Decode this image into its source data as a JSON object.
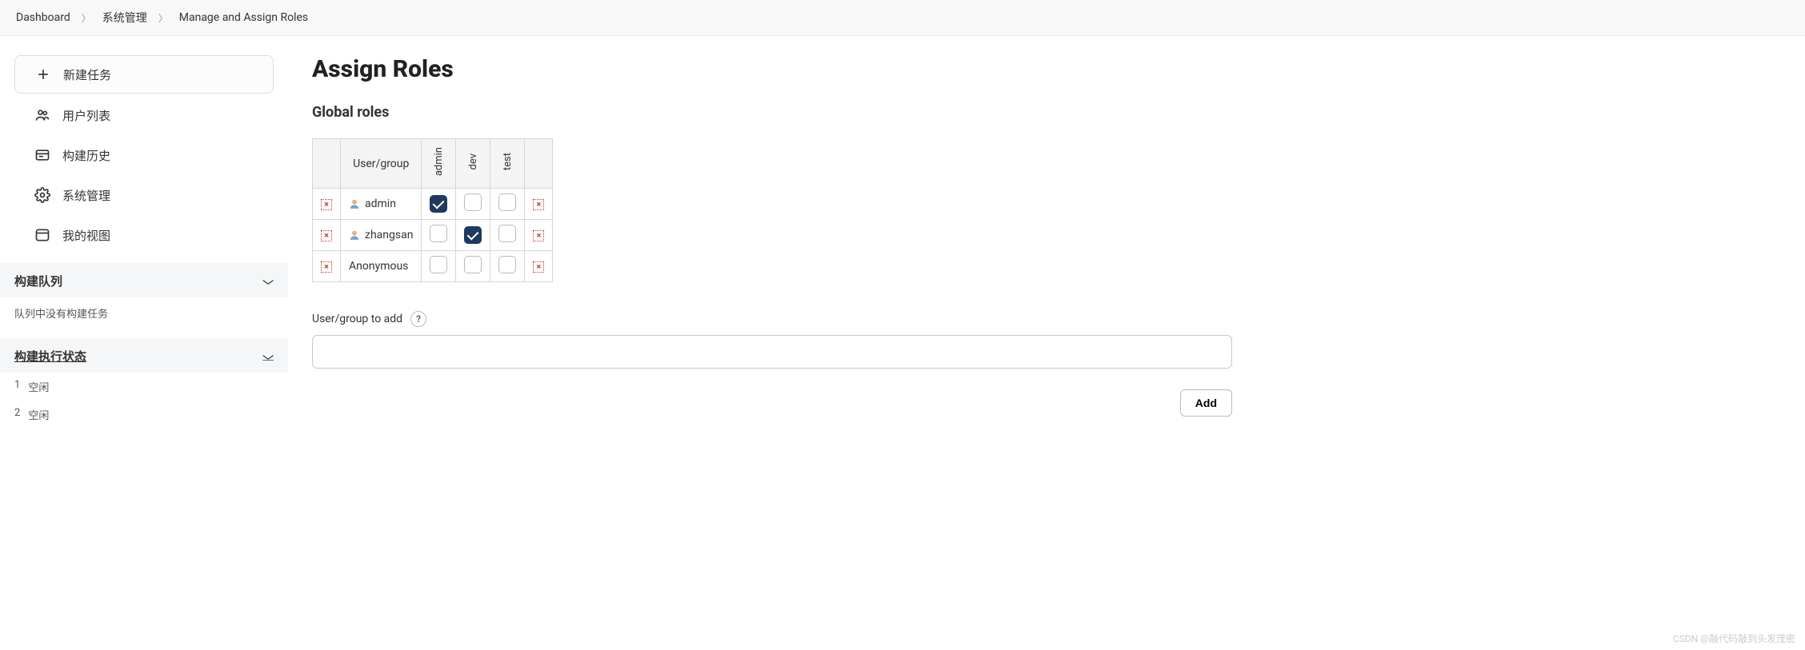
{
  "breadcrumb": {
    "items": [
      "Dashboard",
      "系统管理",
      "Manage and Assign Roles"
    ]
  },
  "sidebar": {
    "newTask": "新建任务",
    "items": [
      {
        "label": "用户列表",
        "icon": "users"
      },
      {
        "label": "构建历史",
        "icon": "history"
      },
      {
        "label": "系统管理",
        "icon": "gear"
      },
      {
        "label": "我的视图",
        "icon": "window"
      }
    ],
    "panel_queue_title": "构建队列",
    "panel_queue_empty": "队列中没有构建任务",
    "panel_exec_title": "构建执行状态",
    "executors": [
      {
        "num": "1",
        "status": "空闲"
      },
      {
        "num": "2",
        "status": "空闲"
      }
    ]
  },
  "main": {
    "title": "Assign Roles",
    "section_global": "Global roles",
    "table": {
      "header_user": "User/group",
      "roles": [
        "admin",
        "dev",
        "test"
      ],
      "rows": [
        {
          "name": "admin",
          "hasIcon": true,
          "checks": [
            true,
            false,
            false
          ]
        },
        {
          "name": "zhangsan",
          "hasIcon": true,
          "checks": [
            false,
            true,
            false
          ]
        },
        {
          "name": "Anonymous",
          "hasIcon": false,
          "checks": [
            false,
            false,
            false
          ]
        }
      ]
    },
    "add_label": "User/group to add",
    "add_button": "Add"
  },
  "watermark": "CSDN @敲代码敲到头发茂密"
}
